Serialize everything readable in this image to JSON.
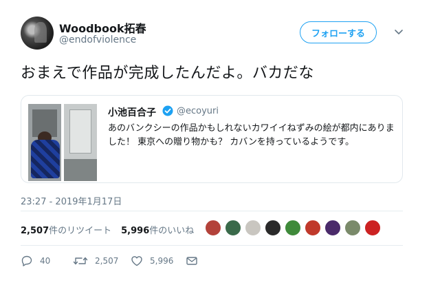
{
  "author": {
    "name": "Woodbook拓春",
    "handle": "@endofviolence",
    "follow_label": "フォローする"
  },
  "tweet": {
    "text": "おまえで作品が完成したんだよ。バカだな",
    "timestamp": "23:27 - 2019年1月17日"
  },
  "quoted": {
    "name": "小池百合子",
    "handle": "@ecoyuri",
    "text": "あのバンクシーの作品かもしれないカワイイねずみの絵が都内にありました！ 東京への贈り物かも？ カバンを持っているようです。"
  },
  "stats": {
    "retweet_count": "2,507",
    "retweet_label": "件のリツイート",
    "like_count": "5,996",
    "like_label": "件のいいね"
  },
  "likers": [
    {
      "icon": "avatar-1",
      "color": "#b3423a"
    },
    {
      "icon": "avatar-2",
      "color": "#3a6a4a"
    },
    {
      "icon": "avatar-3",
      "color": "#c9c6c0"
    },
    {
      "icon": "avatar-4",
      "color": "#2a2a2a"
    },
    {
      "icon": "avatar-5",
      "color": "#3f8a3a"
    },
    {
      "icon": "avatar-6",
      "color": "#c0392b"
    },
    {
      "icon": "avatar-7",
      "color": "#4a2a6a"
    },
    {
      "icon": "avatar-8",
      "color": "#7a8a6a"
    },
    {
      "icon": "avatar-9",
      "color": "#cc2222"
    }
  ],
  "actions": {
    "reply_count": "40",
    "retweet_count": "2,507",
    "like_count": "5,996"
  },
  "colors": {
    "accent": "#1da1f2",
    "secondary_text": "#657786",
    "border": "#e1e8ed"
  }
}
